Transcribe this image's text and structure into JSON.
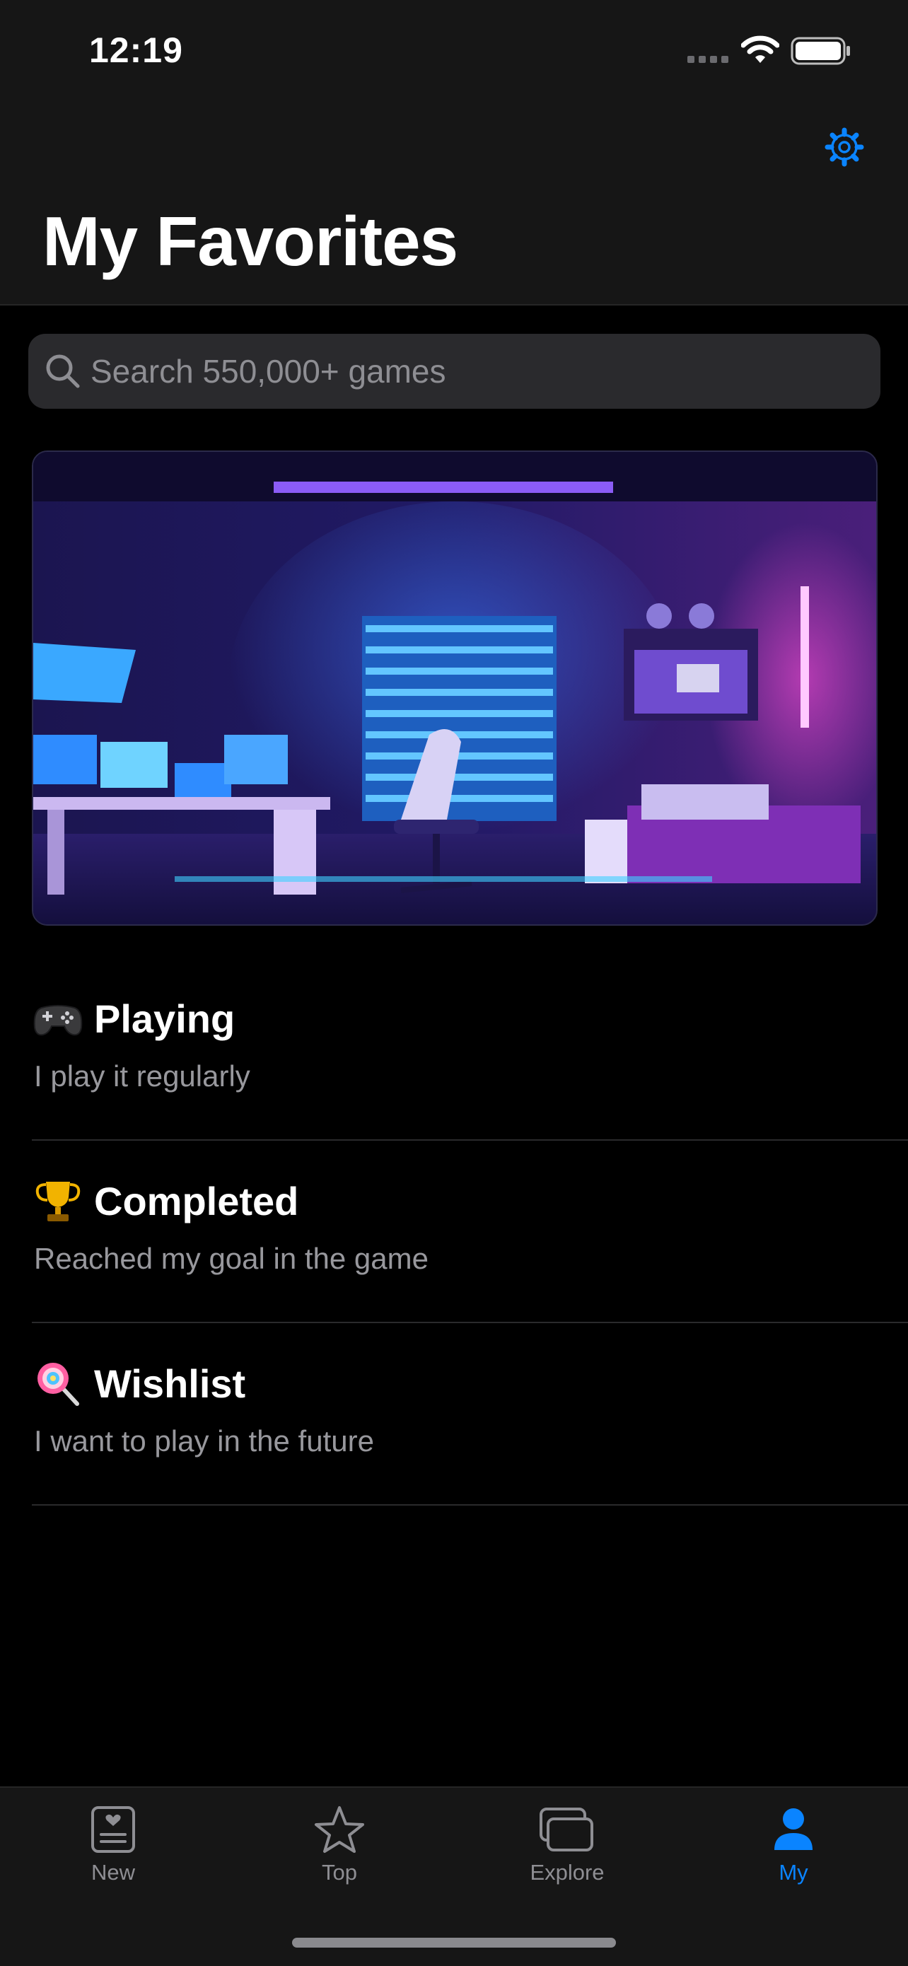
{
  "status_bar": {
    "time": "12:19"
  },
  "header": {
    "title": "My Favorites"
  },
  "search": {
    "placeholder": "Search 550,000+ games",
    "value": ""
  },
  "lists": [
    {
      "icon": "gamepad-icon",
      "title": "Playing",
      "subtitle": "I play it regularly"
    },
    {
      "icon": "trophy-icon",
      "title": "Completed",
      "subtitle": "Reached my goal in the game"
    },
    {
      "icon": "lollipop-icon",
      "title": "Wishlist",
      "subtitle": "I want to play in the future"
    }
  ],
  "tabs": [
    {
      "label": "New",
      "icon": "news-icon",
      "active": false
    },
    {
      "label": "Top",
      "icon": "star-icon",
      "active": false
    },
    {
      "label": "Explore",
      "icon": "cards-icon",
      "active": false
    },
    {
      "label": "My",
      "icon": "person-icon",
      "active": true
    }
  ],
  "colors": {
    "accent": "#0a84ff",
    "background": "#000000",
    "header": "#161616",
    "secondary_text": "#98989d"
  }
}
